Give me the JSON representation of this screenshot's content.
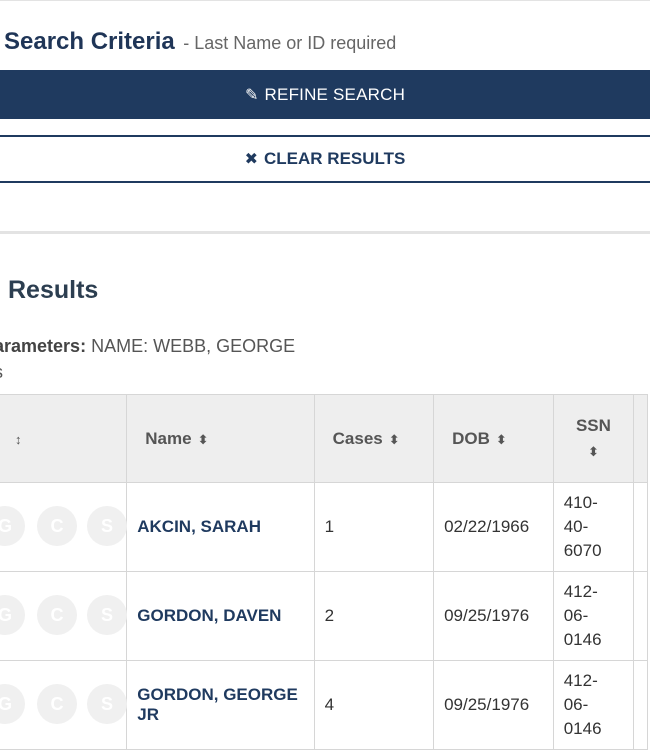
{
  "search": {
    "title": "Search Criteria",
    "subtitle": "- Last Name or ID required",
    "refine_label": "REFINE SEARCH",
    "refine_icon": "pencil-icon",
    "clear_label": "CLEAR RESULTS",
    "clear_icon": "close-icon"
  },
  "results": {
    "title": "Results",
    "params_label": "arameters:",
    "params_value": "NAME: WEBB, GEORGE",
    "params_line2": "s"
  },
  "table": {
    "headers": [
      "↕",
      "Name",
      "Cases",
      "DOB",
      "SSN"
    ],
    "badges": [
      "G",
      "C",
      "S"
    ],
    "rows": [
      {
        "name": "AKCIN, SARAH",
        "cases": "1",
        "dob": "02/22/1966",
        "ssn": [
          "410-",
          "40-",
          "6070"
        ]
      },
      {
        "name": "GORDON, DAVEN",
        "cases": "2",
        "dob": "09/25/1976",
        "ssn": [
          "412-",
          "06-",
          "0146"
        ]
      },
      {
        "name": "GORDON, GEORGE JR",
        "cases": "4",
        "dob": "09/25/1976",
        "ssn": [
          "412-",
          "06-",
          "0146"
        ]
      }
    ]
  }
}
